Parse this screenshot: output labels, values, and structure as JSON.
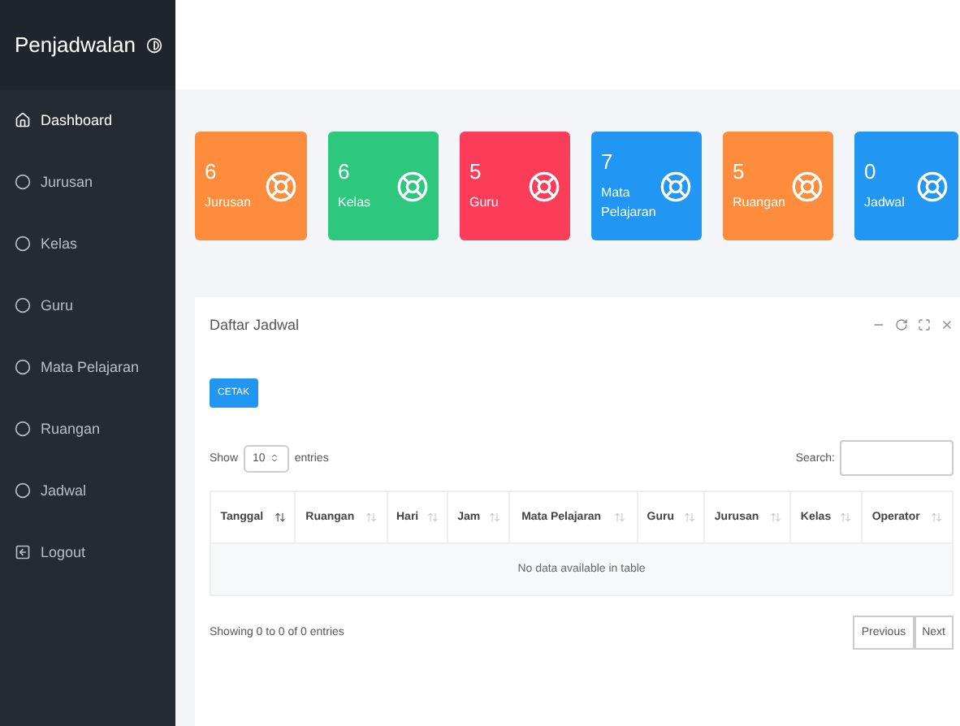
{
  "sidebar": {
    "title": "Penjadwalan",
    "items": [
      {
        "label": "Dashboard",
        "kind": "home",
        "selected": true
      },
      {
        "label": "Jurusan",
        "kind": "circle",
        "selected": false
      },
      {
        "label": "Kelas",
        "kind": "circle",
        "selected": false
      },
      {
        "label": "Guru",
        "kind": "circle",
        "selected": false
      },
      {
        "label": "Mata Pelajaran",
        "kind": "circle",
        "selected": false
      },
      {
        "label": "Ruangan",
        "kind": "circle",
        "selected": false
      },
      {
        "label": "Jadwal",
        "kind": "circle",
        "selected": false
      },
      {
        "label": "Logout",
        "kind": "logout",
        "selected": false
      }
    ]
  },
  "stats": [
    {
      "count": "6",
      "label": "Jurusan",
      "color": "#fd8c3c"
    },
    {
      "count": "6",
      "label": "Kelas",
      "color": "#2dc77e"
    },
    {
      "count": "5",
      "label": "Guru",
      "color": "#fb3d5a"
    },
    {
      "count": "7",
      "label": "Mata Pelajaran",
      "color": "#2196f3"
    },
    {
      "count": "5",
      "label": "Ruangan",
      "color": "#fd8c3c"
    },
    {
      "count": "0",
      "label": "Jadwal",
      "color": "#2196f3"
    }
  ],
  "panel": {
    "title": "Daftar Jadwal",
    "print_button": "CETAK",
    "length": {
      "before": "Show",
      "value": "10",
      "after": "entries"
    },
    "search_label": "Search:",
    "columns": [
      {
        "label": "Tanggal",
        "sorted": true
      },
      {
        "label": "Ruangan",
        "sorted": false
      },
      {
        "label": "Hari",
        "sorted": false
      },
      {
        "label": "Jam",
        "sorted": false
      },
      {
        "label": "Mata Pelajaran",
        "sorted": false
      },
      {
        "label": "Guru",
        "sorted": false
      },
      {
        "label": "Jurusan",
        "sorted": false
      },
      {
        "label": "Kelas",
        "sorted": false
      },
      {
        "label": "Operator",
        "sorted": false
      }
    ],
    "empty": "No data available in table",
    "info": "Showing 0 to 0 of 0 entries",
    "pager": [
      "Previous",
      "Next"
    ]
  }
}
